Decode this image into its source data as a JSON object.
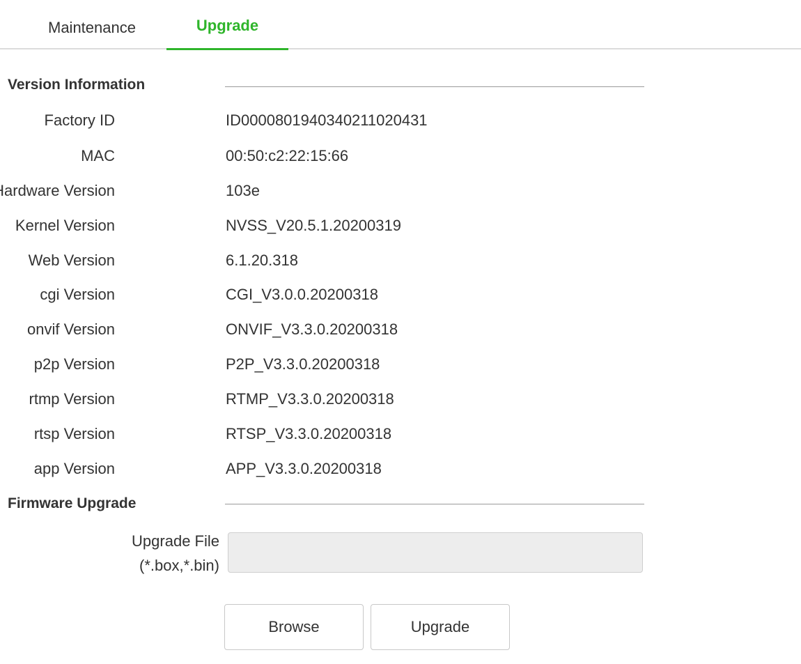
{
  "tabs": [
    {
      "label": "Maintenance",
      "active": false
    },
    {
      "label": "Upgrade",
      "active": true
    }
  ],
  "accent_color": "#2fb52b",
  "version_info": {
    "title": "Version Information",
    "rows": [
      {
        "label": "Factory ID",
        "value": "ID00008019403402110204​31"
      },
      {
        "label": "MAC",
        "value": "00:50:c2:22:15:66"
      },
      {
        "label": "Hardware Version",
        "value": "103e"
      },
      {
        "label": "Kernel Version",
        "value": "NVSS_V20.5.1.20200319"
      },
      {
        "label": "Web Version",
        "value": "6.1.20.318"
      },
      {
        "label": "cgi Version",
        "value": "CGI_V3.0.0.20200318"
      },
      {
        "label": "onvif Version",
        "value": "ONVIF_V3.3.0.20200318"
      },
      {
        "label": "p2p Version",
        "value": "P2P_V3.3.0.20200318"
      },
      {
        "label": "rtmp Version",
        "value": "RTMP_V3.3.0.20200318"
      },
      {
        "label": "rtsp Version",
        "value": "RTSP_V3.3.0.20200318"
      },
      {
        "label": "app Version",
        "value": "APP_V3.3.0.20200318"
      }
    ]
  },
  "firmware": {
    "title": "Firmware Upgrade",
    "file_label_line1": "Upgrade File",
    "file_label_line2": "(*.box,*.bin)",
    "file_value": "",
    "browse_label": "Browse",
    "upgrade_label": "Upgrade"
  }
}
